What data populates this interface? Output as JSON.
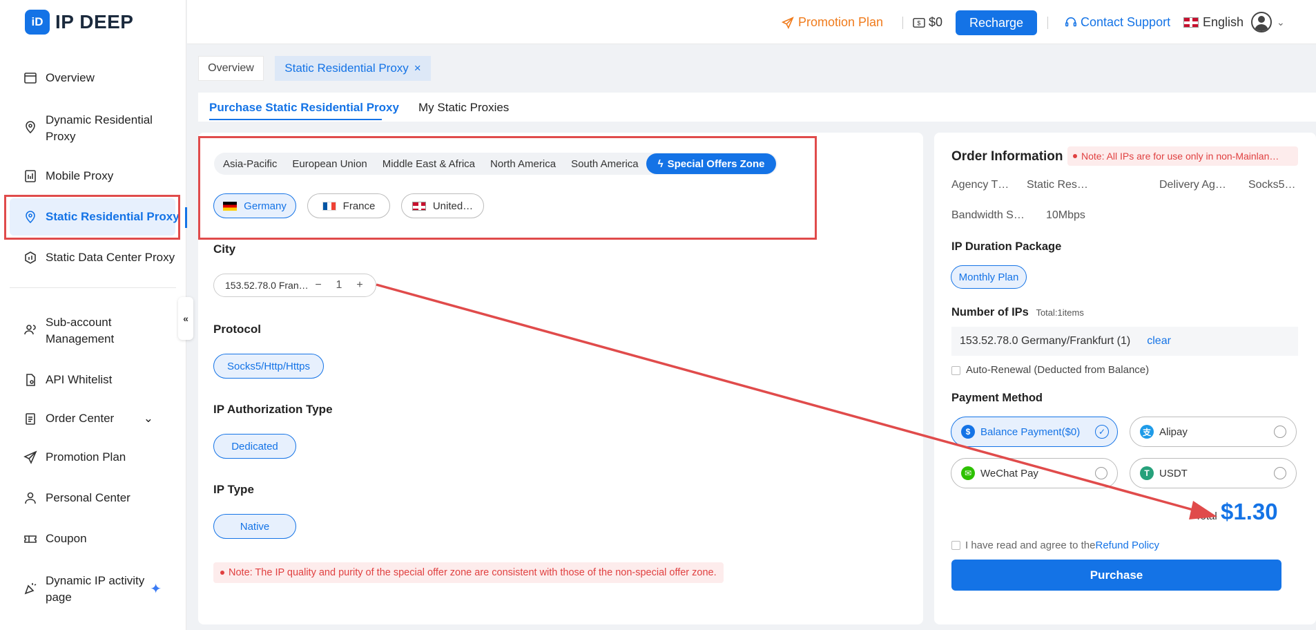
{
  "brand": {
    "logo_mark": "iD",
    "name": "IP DEEP"
  },
  "sidebar": {
    "items": [
      {
        "label": "Overview",
        "icon": "overview-icon"
      },
      {
        "label": "Dynamic Residential Proxy",
        "icon": "location-pin-icon"
      },
      {
        "label": "Mobile Proxy",
        "icon": "mobile-icon"
      },
      {
        "label": "Static Residential Proxy",
        "icon": "location-pin-icon",
        "active": true
      },
      {
        "label": "Static Data Center Proxy",
        "icon": "datacenter-icon"
      },
      {
        "label": "Sub-account Management",
        "icon": "users-icon"
      },
      {
        "label": "API Whitelist",
        "icon": "document-icon"
      },
      {
        "label": "Order Center",
        "icon": "clipboard-icon"
      },
      {
        "label": "Promotion Plan",
        "icon": "send-icon"
      },
      {
        "label": "Personal Center",
        "icon": "user-icon"
      },
      {
        "label": "Coupon",
        "icon": "ticket-icon"
      },
      {
        "label": "Dynamic IP activity page",
        "icon": "party-icon"
      }
    ],
    "collapse_glyph": "«"
  },
  "header": {
    "promotion": "Promotion Plan",
    "balance": "$0",
    "recharge": "Recharge",
    "support": "Contact Support",
    "language": "English"
  },
  "tabs": {
    "overview": "Overview",
    "current": "Static Residential Proxy",
    "close": "×"
  },
  "subtabs": {
    "purchase": "Purchase Static Residential Proxy",
    "my_proxies": "My Static Proxies"
  },
  "regions": [
    "Asia-Pacific",
    "European Union",
    "Middle East & Africa",
    "North America",
    "South America"
  ],
  "special_region": "Special Offers Zone",
  "countries": [
    "Germany",
    "France",
    "United…"
  ],
  "city": {
    "label": "City",
    "value": "153.52.78.0 Fran…",
    "minus": "−",
    "qty": "1",
    "plus": "+"
  },
  "protocol": {
    "label": "Protocol",
    "value": "Socks5/Http/Https"
  },
  "auth_type": {
    "label": "IP Authorization Type",
    "value": "Dedicated"
  },
  "ip_type": {
    "label": "IP Type",
    "value": "Native"
  },
  "main_note": "Note: The IP quality and purity of the special offer zone are consistent with those of the non-special offer zone.",
  "order": {
    "title": "Order Information",
    "note": "Note: All IPs are for use only in non-Mainlan…",
    "fields": {
      "agency": "Agency T…",
      "static_res": "Static Res…",
      "delivery": "Delivery Ag…",
      "socks": "Socks5…",
      "bandwidth_label": "Bandwidth S…",
      "bandwidth_value": "10Mbps"
    },
    "duration_label": "IP Duration Package",
    "duration_value": "Monthly Plan",
    "num_ips_label": "Number of IPs",
    "num_ips_total": "Total:1items",
    "ip_entry": "153.52.78.0 Germany/Frankfurt (1)",
    "clear": "clear",
    "auto_renew": "Auto-Renewal (Deducted from Balance)",
    "payment_label": "Payment Method",
    "payments": {
      "balance": "Balance Payment($0)",
      "alipay": "Alipay",
      "wechat": "WeChat Pay",
      "usdt": "USDT"
    },
    "total_label": "Total",
    "total_value": "$1.30",
    "agree_text": "I have read and agree to the",
    "refund_link": "Refund Policy",
    "purchase": "Purchase"
  },
  "colors": {
    "accent": "#1473e6",
    "promo": "#f07b1c",
    "annotation_red": "#e04b4b",
    "note_red": "#e04040"
  }
}
